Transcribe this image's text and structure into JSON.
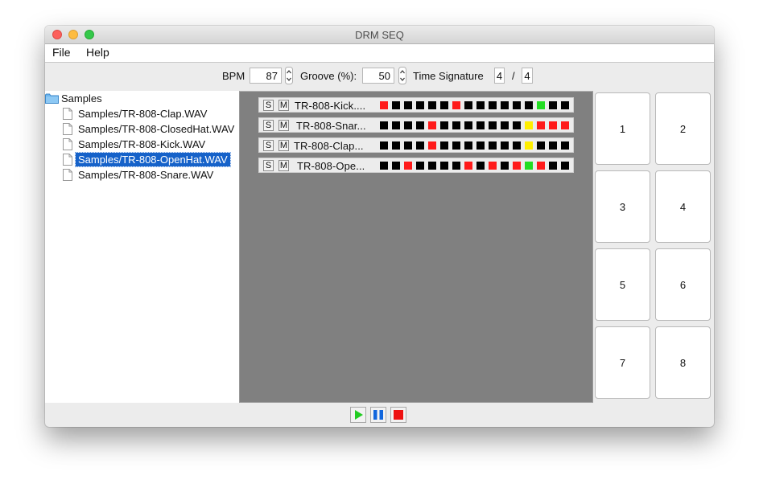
{
  "window": {
    "title": "DRM SEQ"
  },
  "menubar": {
    "items": [
      "File",
      "Help"
    ]
  },
  "toolbar": {
    "bpm_label": "BPM",
    "bpm_value": "87",
    "groove_label": "Groove (%):",
    "groove_value": "50",
    "timesig_label": "Time Signature",
    "timesig_num": "4",
    "timesig_sep": "/",
    "timesig_den": "4"
  },
  "tree": {
    "root": "Samples",
    "items": [
      "Samples/TR-808-Clap.WAV",
      "Samples/TR-808-ClosedHat.WAV",
      "Samples/TR-808-Kick.WAV",
      "Samples/TR-808-OpenHat.WAV",
      "Samples/TR-808-Snare.WAV"
    ],
    "selected_index": 3
  },
  "sequencer": {
    "solo_label": "S",
    "mute_label": "M",
    "colors": {
      "off": "#000000",
      "on": "#ff1a1a",
      "yellow": "#ffee00",
      "green": "#22dd22"
    },
    "tracks": [
      {
        "name": "TR-808-Kick....",
        "steps": [
          "on",
          "off",
          "off",
          "off",
          "off",
          "off",
          "on",
          "off",
          "off",
          "off",
          "off",
          "off",
          "off",
          "green",
          "off",
          "off"
        ]
      },
      {
        "name": "TR-808-Snar...",
        "steps": [
          "off",
          "off",
          "off",
          "off",
          "on",
          "off",
          "off",
          "off",
          "off",
          "off",
          "off",
          "off",
          "yellow",
          "on",
          "on",
          "on"
        ]
      },
      {
        "name": "TR-808-Clap...",
        "steps": [
          "off",
          "off",
          "off",
          "off",
          "on",
          "off",
          "off",
          "off",
          "off",
          "off",
          "off",
          "off",
          "yellow",
          "off",
          "off",
          "off"
        ]
      },
      {
        "name": "TR-808-Ope...",
        "steps": [
          "off",
          "off",
          "on",
          "off",
          "off",
          "off",
          "off",
          "on",
          "off",
          "on",
          "off",
          "on",
          "green",
          "on",
          "off",
          "off"
        ]
      }
    ]
  },
  "pads": [
    "1",
    "2",
    "3",
    "4",
    "5",
    "6",
    "7",
    "8"
  ],
  "transport": {
    "play_color": "#22cc22",
    "pause_color": "#1166dd",
    "stop_color": "#ee1111"
  },
  "icons": {
    "folder": "folder-icon",
    "file": "file-icon",
    "spinner": "spinner-arrows-icon",
    "play": "play-icon",
    "pause": "pause-icon",
    "stop": "stop-icon"
  }
}
